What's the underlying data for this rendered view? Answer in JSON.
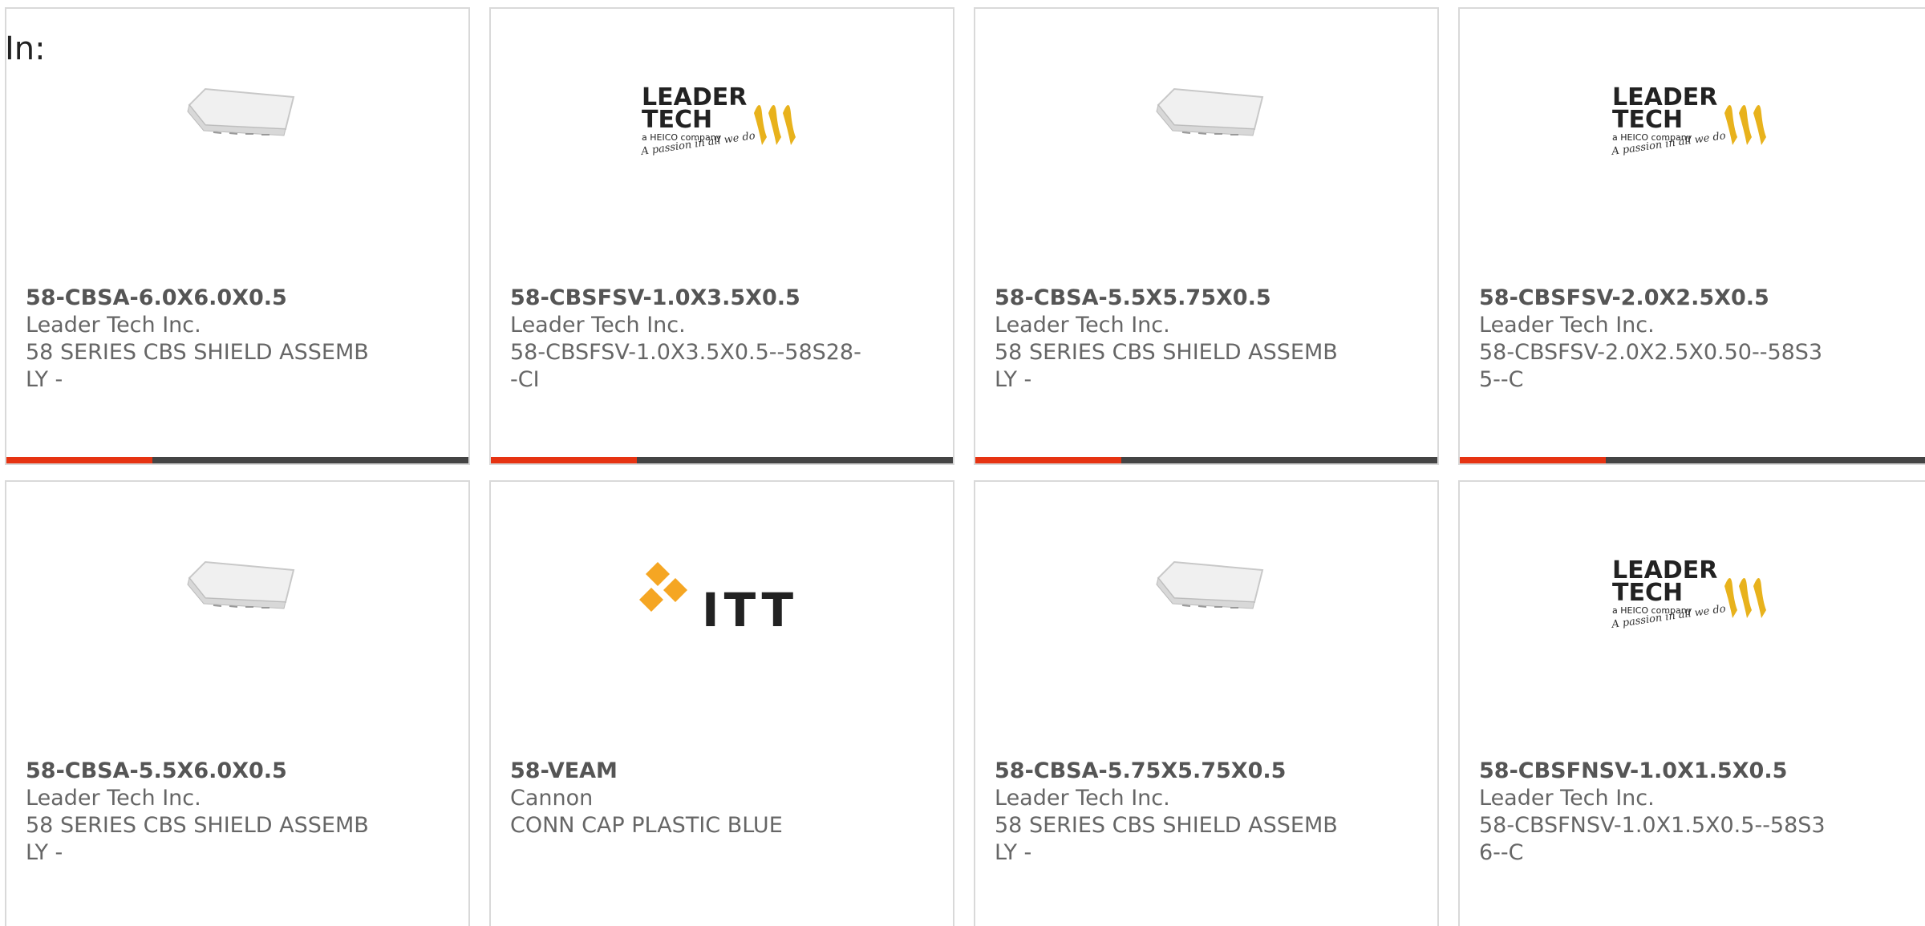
{
  "header": {
    "in_label": "In:"
  },
  "products": [
    {
      "part": "58-CBSA-6.0X6.0X0.5",
      "maker": "Leader Tech Inc.",
      "desc": "58 SERIES CBS SHIELD ASSEMBLY -",
      "image": "shield-photo"
    },
    {
      "part": "58-CBSFSV-1.0X3.5X0.5",
      "maker": "Leader Tech Inc.",
      "desc": "58-CBSFSV-1.0X3.5X0.5--58S28--CI",
      "image": "leader-tech-logo"
    },
    {
      "part": "58-CBSA-5.5X5.75X0.5",
      "maker": "Leader Tech Inc.",
      "desc": "58 SERIES CBS SHIELD ASSEMBLY -",
      "image": "shield-photo"
    },
    {
      "part": "58-CBSFSV-2.0X2.5X0.5",
      "maker": "Leader Tech Inc.",
      "desc": "58-CBSFSV-2.0X2.5X0.50--58S35--C",
      "image": "leader-tech-logo"
    },
    {
      "part": "58-CBSA-5.5X6.0X0.5",
      "maker": "Leader Tech Inc.",
      "desc": "58 SERIES CBS SHIELD ASSEMBLY -",
      "image": "shield-photo"
    },
    {
      "part": "58-VEAM",
      "maker": "Cannon",
      "desc": "CONN CAP PLASTIC BLUE",
      "image": "itt-logo"
    },
    {
      "part": "58-CBSA-5.75X5.75X0.5",
      "maker": "Leader Tech Inc.",
      "desc": "58 SERIES CBS SHIELD ASSEMBLY -",
      "image": "shield-photo"
    },
    {
      "part": "58-CBSFNSV-1.0X1.5X0.5",
      "maker": "Leader Tech Inc.",
      "desc": "58-CBSFNSV-1.0X1.5X0.5--58S36--C",
      "image": "leader-tech-logo"
    }
  ],
  "logos": {
    "leader_line1": "LEADER",
    "leader_line2": "TECH",
    "leader_sub": "a HEICO company",
    "leader_tagline": "A passion in all we do",
    "itt": "ITT"
  },
  "colors": {
    "accent_bar": "#e63312",
    "bar": "#444444",
    "leader_yellow": "#e8b21c",
    "itt_orange": "#f5a623"
  }
}
